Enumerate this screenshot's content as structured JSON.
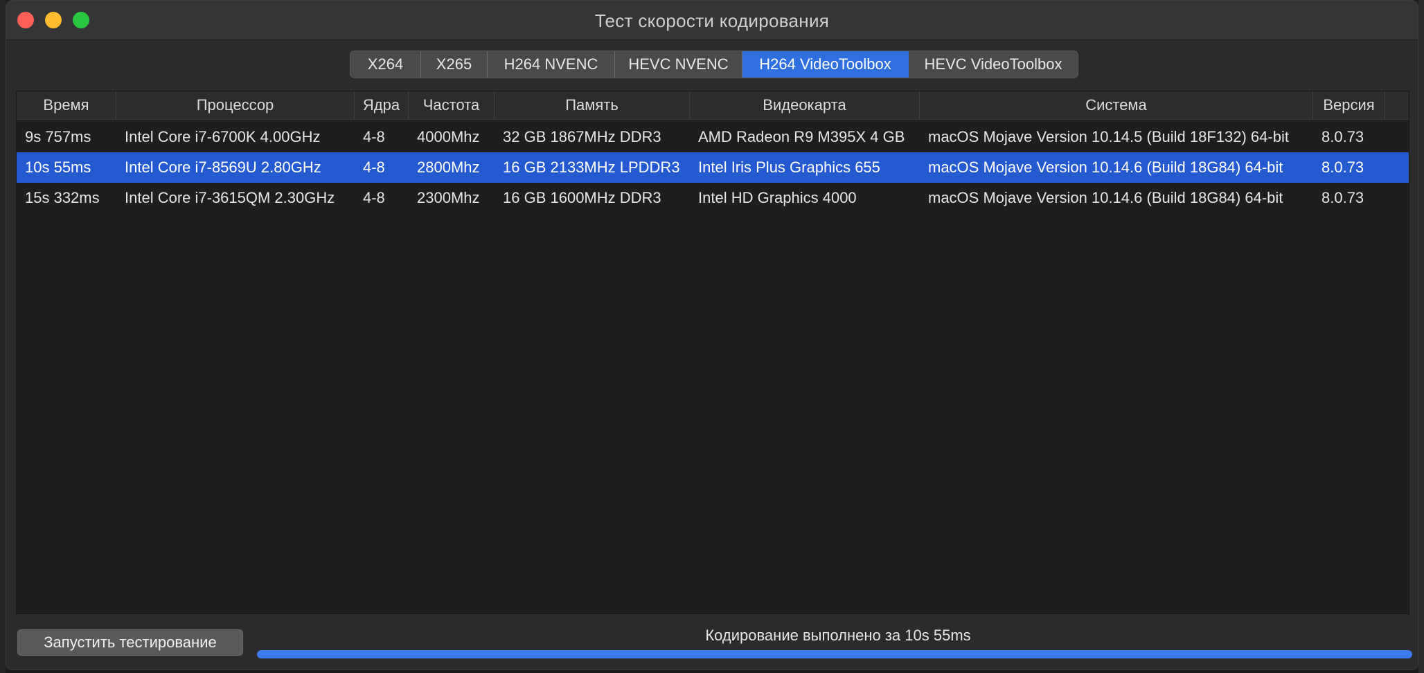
{
  "window": {
    "title": "Тест скорости кодирования"
  },
  "tabs": [
    {
      "label": "X264",
      "active": false
    },
    {
      "label": "X265",
      "active": false
    },
    {
      "label": "H264 NVENC",
      "active": false
    },
    {
      "label": "HEVC NVENC",
      "active": false
    },
    {
      "label": "H264 VideoToolbox",
      "active": true
    },
    {
      "label": "HEVC VideoToolbox",
      "active": false
    }
  ],
  "table": {
    "columns": [
      "Время",
      "Процессор",
      "Ядра",
      "Частота",
      "Память",
      "Видеокарта",
      "Система",
      "Версия"
    ],
    "rows": [
      [
        "9s 757ms",
        "Intel Core i7-6700K 4.00GHz",
        "4-8",
        "4000Mhz",
        "32 GB 1867MHz DDR3",
        "AMD Radeon R9 M395X 4 GB",
        "macOS Mojave Version 10.14.5 (Build 18F132) 64-bit",
        "8.0.73"
      ],
      [
        "10s 55ms",
        "Intel Core i7-8569U 2.80GHz",
        "4-8",
        "2800Mhz",
        "16 GB 2133MHz LPDDR3",
        "Intel Iris Plus Graphics 655",
        "macOS Mojave Version 10.14.6 (Build 18G84) 64-bit",
        "8.0.73"
      ],
      [
        "15s 332ms",
        "Intel Core i7-3615QM 2.30GHz",
        "4-8",
        "2300Mhz",
        "16 GB 1600MHz DDR3",
        "Intel HD Graphics 4000",
        "macOS Mojave Version 10.14.6 (Build 18G84) 64-bit",
        "8.0.73"
      ]
    ],
    "selected_row": 1
  },
  "footer": {
    "run_button": "Запустить тестирование",
    "status": "Кодирование выполнено за 10s 55ms",
    "progress": 1.0
  },
  "colors": {
    "accent": "#2f6fe0",
    "selection": "#2459cf",
    "progress": "#3d7bf0",
    "close": "#ff5f57",
    "minimize": "#febc2e",
    "maximize": "#28c840"
  }
}
